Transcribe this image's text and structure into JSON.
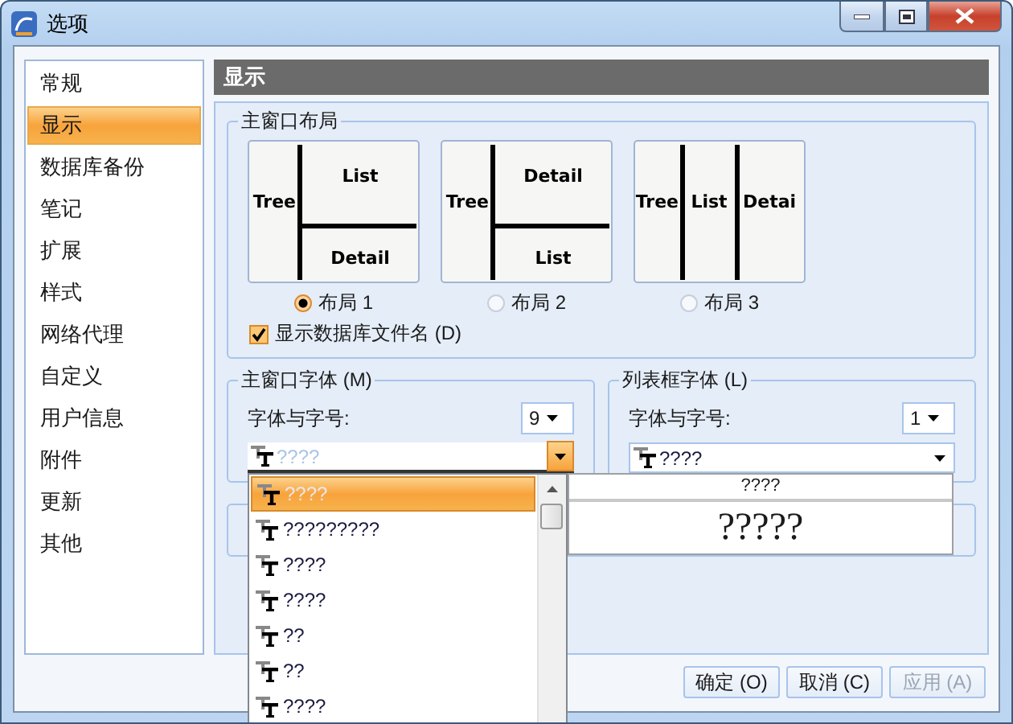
{
  "window": {
    "title": "选项"
  },
  "sidebar": {
    "items": [
      {
        "label": "常规",
        "selected": false
      },
      {
        "label": "显示",
        "selected": true
      },
      {
        "label": "数据库备份",
        "selected": false
      },
      {
        "label": "笔记",
        "selected": false
      },
      {
        "label": "扩展",
        "selected": false
      },
      {
        "label": "样式",
        "selected": false
      },
      {
        "label": "网络代理",
        "selected": false
      },
      {
        "label": "自定义",
        "selected": false
      },
      {
        "label": "用户信息",
        "selected": false
      },
      {
        "label": "附件",
        "selected": false
      },
      {
        "label": "更新",
        "selected": false
      },
      {
        "label": "其他",
        "selected": false
      }
    ]
  },
  "section": {
    "title": "显示"
  },
  "layout_group": {
    "title": "主窗口布局",
    "layouts": [
      {
        "kind": "stacked",
        "panes": [
          "Tree",
          "List",
          "Detail"
        ],
        "label": "布局 1",
        "selected": true
      },
      {
        "kind": "stacked",
        "panes": [
          "Tree",
          "Detail",
          "List"
        ],
        "label": "布局 2",
        "selected": false
      },
      {
        "kind": "columns",
        "panes": [
          "Tree",
          "List",
          "Detai"
        ],
        "label": "布局 3",
        "selected": false
      }
    ],
    "show_db_filename": {
      "label": "显示数据库文件名 (D)",
      "checked": true
    }
  },
  "main_font": {
    "title": "主窗口字体 (M)",
    "label": "字体与字号:",
    "size": "9",
    "font": "????",
    "options": [
      {
        "label": "????",
        "selected": true
      },
      {
        "label": "?????????",
        "selected": false
      },
      {
        "label": "????",
        "selected": false
      },
      {
        "label": "????",
        "selected": false
      },
      {
        "label": "??",
        "selected": false
      },
      {
        "label": "??",
        "selected": false
      },
      {
        "label": "????",
        "selected": false
      }
    ]
  },
  "list_font": {
    "title": "列表框字体 (L)",
    "label": "字体与字号:",
    "size": "1",
    "font": "????"
  },
  "preview": {
    "caption": "????",
    "sample": "?????"
  },
  "buttons": [
    {
      "label": "确定 (O)",
      "disabled": false
    },
    {
      "label": "取消 (C)",
      "disabled": false
    },
    {
      "label": "应用 (A)",
      "disabled": true
    }
  ]
}
